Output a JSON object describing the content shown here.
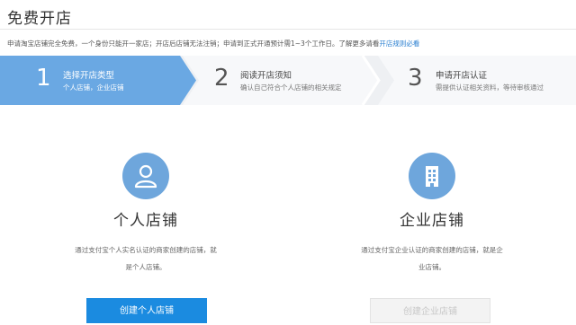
{
  "page": {
    "title": "免费开店",
    "notice_text": "申请淘宝店铺完全免费，一个身份只能开一家店；开店后店铺无法注销；申请到正式开通预计需1~3个工作日。了解更多请看",
    "notice_link": "开店规则必看"
  },
  "steps": [
    {
      "number": "1",
      "name": "选择开店类型",
      "desc": "个人店铺，企业店铺",
      "state": "active"
    },
    {
      "number": "2",
      "name": "阅读开店须知",
      "desc": "确认自己符合个人店铺的相关规定",
      "state": "inactive"
    },
    {
      "number": "3",
      "name": "申请开店认证",
      "desc": "需提供认证相关资料，等待审核通过",
      "state": "inactive"
    }
  ],
  "options": [
    {
      "icon": "person-icon",
      "label": "个人店铺",
      "desc": "通过支付宝个人实名认证的商家创建的店铺，就是个人店铺。",
      "button": "创建个人店铺",
      "button_state": "enabled"
    },
    {
      "icon": "building-icon",
      "label": "企业店铺",
      "desc": "通过支付宝企业认证的商家创建的店铺，就是企业店铺。",
      "button": "创建企业店铺",
      "button_state": "disabled"
    }
  ],
  "colors": {
    "active_step": "#6aa8e3",
    "step_bg": "#eef0f3",
    "icon_circle": "#6ea6dc",
    "primary_button": "#1b8be0",
    "link": "#2a7fd0"
  }
}
